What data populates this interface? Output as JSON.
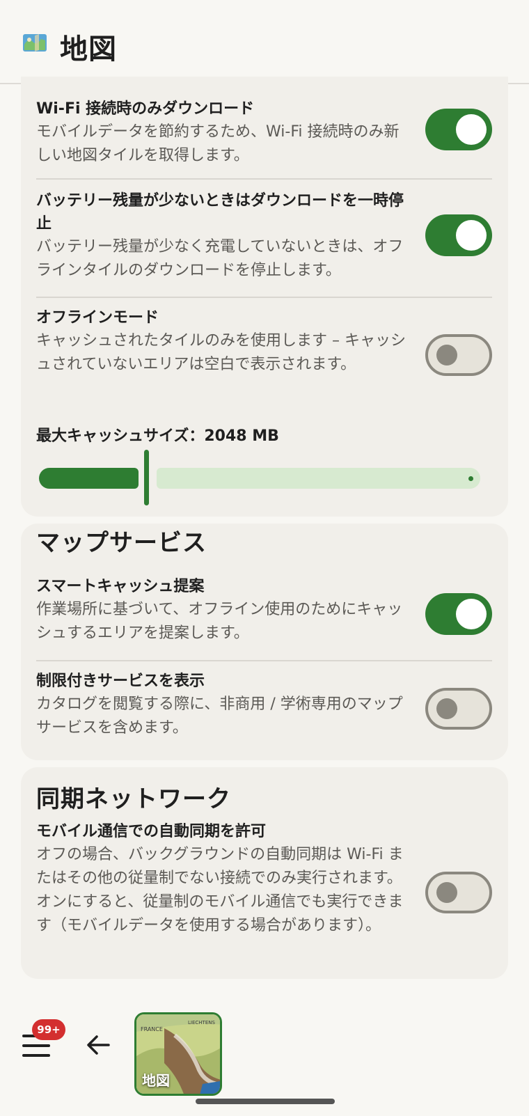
{
  "header": {
    "title": "地図",
    "icon": "map-icon"
  },
  "downloads": {
    "wifi_only": {
      "title": "Wi-Fi 接続時のみダウンロード",
      "desc": "モバイルデータを節約するため、Wi-Fi 接続時のみ新しい地図タイルを取得します。",
      "enabled": true
    },
    "pause_low_battery": {
      "title": "バッテリー残量が少ないときはダウンロードを一時停止",
      "desc": "バッテリー残量が少なく充電していないときは、オフラインタイルのダウンロードを停止します。",
      "enabled": true
    },
    "offline_mode": {
      "title": "オフラインモード",
      "desc": "キャッシュされたタイルのみを使用します – キャッシュされていないエリアは空白で表示されます。",
      "enabled": false
    },
    "cache_size": {
      "label": "最大キャッシュサイズ：2048 MB",
      "value_fraction": 0.24
    }
  },
  "map_services": {
    "title": "マップサービス",
    "smart_cache": {
      "title": "スマートキャッシュ提案",
      "desc": "作業場所に基づいて、オフライン使用のためにキャッシュするエリアを提案します。",
      "enabled": true
    },
    "restricted": {
      "title": "制限付きサービスを表示",
      "desc": "カタログを閲覧する際に、非商用 / 学術専用のマップサービスを含めます。",
      "enabled": false
    }
  },
  "sync_network": {
    "title": "同期ネットワーク",
    "mobile_sync": {
      "title": "モバイル通信での自動同期を許可",
      "desc": "オフの場合、バックグラウンドの自動同期は Wi-Fi またはその他の従量制でない接続でのみ実行されます。オンにすると、従量制のモバイル通信でも実行できます（モバイルデータを使用する場合があります）。",
      "enabled": false
    }
  },
  "bottom_bar": {
    "badge": "99+",
    "thumb_label": "地図",
    "thumb_map_labels": [
      "FRANCE",
      "LIECHTENS"
    ],
    "colors": {
      "accent": "#2e7d32",
      "badge": "#d32f2f"
    }
  }
}
